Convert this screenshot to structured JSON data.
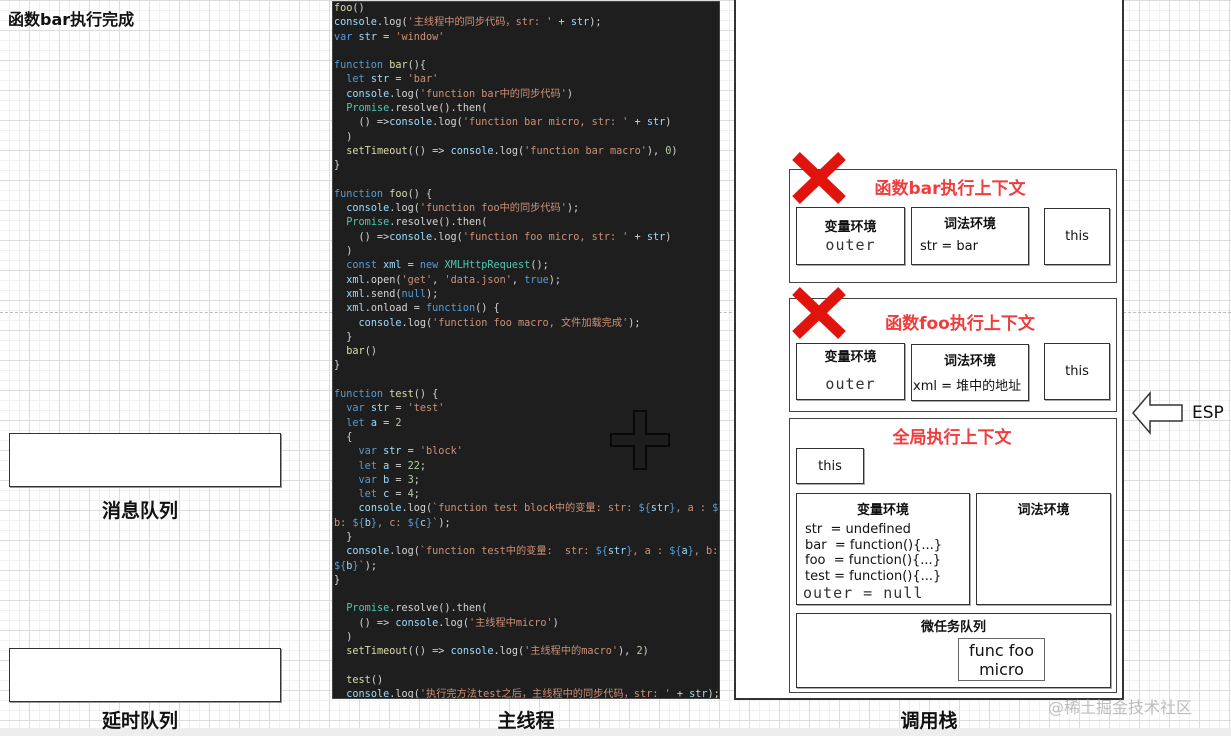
{
  "status_title": "函数bar执行完成",
  "labels": {
    "message_queue": "消息队列",
    "delay_queue": "延时队列",
    "main_thread": "主线程",
    "call_stack": "调用栈"
  },
  "esp_label": "ESP",
  "watermark": "@稀土掘金技术社区",
  "code_lines": [
    [
      [
        "fn",
        "foo"
      ],
      [
        "",
        "()"
      ]
    ],
    [
      [
        "id",
        "console"
      ],
      [
        "",
        ".log("
      ],
      [
        "str",
        "'主线程中的同步代码，str: '"
      ],
      [
        "",
        " + "
      ],
      [
        "id",
        "str"
      ],
      [
        "",
        ");"
      ]
    ],
    [
      [
        "kw",
        "var"
      ],
      [
        "",
        " "
      ],
      [
        "id",
        "str"
      ],
      [
        "",
        " = "
      ],
      [
        "str",
        "'window'"
      ]
    ],
    [],
    [
      [
        "kw",
        "function"
      ],
      [
        "",
        " "
      ],
      [
        "fn",
        "bar"
      ],
      [
        "",
        "(){"
      ]
    ],
    [
      [
        "",
        "  "
      ],
      [
        "kw",
        "let"
      ],
      [
        "",
        " "
      ],
      [
        "id",
        "str"
      ],
      [
        "",
        " = "
      ],
      [
        "str",
        "'bar'"
      ]
    ],
    [
      [
        "",
        "  "
      ],
      [
        "id",
        "console"
      ],
      [
        "",
        ".log("
      ],
      [
        "str",
        "'function bar中的同步代码'"
      ],
      [
        "",
        ")"
      ]
    ],
    [
      [
        "",
        "  "
      ],
      [
        "cls",
        "Promise"
      ],
      [
        "",
        ".resolve().then("
      ]
    ],
    [
      [
        "",
        "    () =>"
      ],
      [
        "id",
        "console"
      ],
      [
        "",
        ".log("
      ],
      [
        "str",
        "'function bar micro, str: '"
      ],
      [
        "",
        " + "
      ],
      [
        "id",
        "str"
      ],
      [
        "",
        ")"
      ]
    ],
    [
      [
        "",
        "  )"
      ]
    ],
    [
      [
        "",
        "  "
      ],
      [
        "fn",
        "setTimeout"
      ],
      [
        "",
        "(() => "
      ],
      [
        "id",
        "console"
      ],
      [
        "",
        ".log("
      ],
      [
        "str",
        "'function bar macro'"
      ],
      [
        "",
        "), "
      ],
      [
        "num",
        "0"
      ],
      [
        "",
        ")"
      ]
    ],
    [
      [
        "",
        "}"
      ]
    ],
    [],
    [
      [
        "kw",
        "function"
      ],
      [
        "",
        " "
      ],
      [
        "fn",
        "foo"
      ],
      [
        "",
        "() {"
      ]
    ],
    [
      [
        "",
        "  "
      ],
      [
        "id",
        "console"
      ],
      [
        "",
        ".log("
      ],
      [
        "str",
        "'function foo中的同步代码'"
      ],
      [
        "",
        ");"
      ]
    ],
    [
      [
        "",
        "  "
      ],
      [
        "cls",
        "Promise"
      ],
      [
        "",
        ".resolve().then("
      ]
    ],
    [
      [
        "",
        "    () =>"
      ],
      [
        "id",
        "console"
      ],
      [
        "",
        ".log("
      ],
      [
        "str",
        "'function foo micro, str: '"
      ],
      [
        "",
        " + "
      ],
      [
        "id",
        "str"
      ],
      [
        "",
        ")"
      ]
    ],
    [
      [
        "",
        "  )"
      ]
    ],
    [
      [
        "",
        "  "
      ],
      [
        "kw",
        "const"
      ],
      [
        "",
        " "
      ],
      [
        "id",
        "xml"
      ],
      [
        "",
        " = "
      ],
      [
        "kw",
        "new"
      ],
      [
        "",
        " "
      ],
      [
        "cls",
        "XMLHttpRequest"
      ],
      [
        "",
        "();"
      ]
    ],
    [
      [
        "",
        "  "
      ],
      [
        "id",
        "xml"
      ],
      [
        "",
        ".open("
      ],
      [
        "str",
        "'get'"
      ],
      [
        "",
        ", "
      ],
      [
        "str",
        "'data.json'"
      ],
      [
        "",
        ", "
      ],
      [
        "kw",
        "true"
      ],
      [
        "",
        ");"
      ]
    ],
    [
      [
        "",
        "  "
      ],
      [
        "id",
        "xml"
      ],
      [
        "",
        ".send("
      ],
      [
        "kw",
        "null"
      ],
      [
        "",
        ");"
      ]
    ],
    [
      [
        "",
        "  "
      ],
      [
        "id",
        "xml"
      ],
      [
        "",
        ".onload = "
      ],
      [
        "kw",
        "function"
      ],
      [
        "",
        "() {"
      ]
    ],
    [
      [
        "",
        "    "
      ],
      [
        "id",
        "console"
      ],
      [
        "",
        ".log("
      ],
      [
        "str",
        "'function foo macro, 文件加载完成'"
      ],
      [
        "",
        ");"
      ]
    ],
    [
      [
        "",
        "  }"
      ]
    ],
    [
      [
        "",
        "  "
      ],
      [
        "fn",
        "bar"
      ],
      [
        "",
        "()"
      ]
    ],
    [
      [
        "",
        "}"
      ]
    ],
    [],
    [
      [
        "kw",
        "function"
      ],
      [
        "",
        " "
      ],
      [
        "fn",
        "test"
      ],
      [
        "",
        "() {"
      ]
    ],
    [
      [
        "",
        "  "
      ],
      [
        "kw",
        "var"
      ],
      [
        "",
        " "
      ],
      [
        "id",
        "str"
      ],
      [
        "",
        " = "
      ],
      [
        "str",
        "'test'"
      ]
    ],
    [
      [
        "",
        "  "
      ],
      [
        "kw",
        "let"
      ],
      [
        "",
        " "
      ],
      [
        "id",
        "a"
      ],
      [
        "",
        " = "
      ],
      [
        "num",
        "2"
      ]
    ],
    [
      [
        "",
        "  {"
      ]
    ],
    [
      [
        "",
        "    "
      ],
      [
        "kw",
        "var"
      ],
      [
        "",
        " "
      ],
      [
        "id",
        "str"
      ],
      [
        "",
        " = "
      ],
      [
        "str",
        "'block'"
      ]
    ],
    [
      [
        "",
        "    "
      ],
      [
        "kw",
        "let"
      ],
      [
        "",
        " "
      ],
      [
        "id",
        "a"
      ],
      [
        "",
        " = "
      ],
      [
        "num",
        "22"
      ],
      [
        "",
        ";"
      ]
    ],
    [
      [
        "",
        "    "
      ],
      [
        "kw",
        "var"
      ],
      [
        "",
        " "
      ],
      [
        "id",
        "b"
      ],
      [
        "",
        " = "
      ],
      [
        "num",
        "3"
      ],
      [
        "",
        ";"
      ]
    ],
    [
      [
        "",
        "    "
      ],
      [
        "kw",
        "let"
      ],
      [
        "",
        " "
      ],
      [
        "id",
        "c"
      ],
      [
        "",
        " = "
      ],
      [
        "num",
        "4"
      ],
      [
        "",
        ";"
      ]
    ],
    [
      [
        "",
        "    "
      ],
      [
        "id",
        "console"
      ],
      [
        "",
        ".log("
      ],
      [
        "str",
        "`function test block中的变量: str: "
      ],
      [
        "kw",
        "${"
      ],
      [
        "id",
        "str"
      ],
      [
        "kw",
        "}"
      ],
      [
        "str",
        ", a : "
      ],
      [
        "kw",
        "${"
      ],
      [
        "id",
        "a"
      ],
      [
        "kw",
        "}"
      ],
      [
        "str",
        ","
      ]
    ],
    [
      [
        "str",
        "b: "
      ],
      [
        "kw",
        "${"
      ],
      [
        "id",
        "b"
      ],
      [
        "kw",
        "}"
      ],
      [
        "str",
        ", c: "
      ],
      [
        "kw",
        "${"
      ],
      [
        "id",
        "c"
      ],
      [
        "kw",
        "}"
      ],
      [
        "str",
        "`"
      ],
      [
        "",
        ");"
      ]
    ],
    [
      [
        "",
        "  }"
      ]
    ],
    [
      [
        "",
        "  "
      ],
      [
        "id",
        "console"
      ],
      [
        "",
        ".log("
      ],
      [
        "str",
        "`function test中的变量:  str: "
      ],
      [
        "kw",
        "${"
      ],
      [
        "id",
        "str"
      ],
      [
        "kw",
        "}"
      ],
      [
        "str",
        ", a : "
      ],
      [
        "kw",
        "${"
      ],
      [
        "id",
        "a"
      ],
      [
        "kw",
        "}"
      ],
      [
        "str",
        ", b:"
      ]
    ],
    [
      [
        "kw",
        "${"
      ],
      [
        "id",
        "b"
      ],
      [
        "kw",
        "}"
      ],
      [
        "str",
        "`"
      ],
      [
        "",
        ");"
      ]
    ],
    [
      [
        "",
        "}"
      ]
    ],
    [],
    [
      [
        "",
        "  "
      ],
      [
        "cls",
        "Promise"
      ],
      [
        "",
        ".resolve().then("
      ]
    ],
    [
      [
        "",
        "    () => "
      ],
      [
        "id",
        "console"
      ],
      [
        "",
        ".log("
      ],
      [
        "str",
        "'主线程中micro'"
      ],
      [
        "",
        ")"
      ]
    ],
    [
      [
        "",
        "  )"
      ]
    ],
    [
      [
        "",
        "  "
      ],
      [
        "fn",
        "setTimeout"
      ],
      [
        "",
        "(() => "
      ],
      [
        "id",
        "console"
      ],
      [
        "",
        ".log("
      ],
      [
        "str",
        "'主线程中的macro'"
      ],
      [
        "",
        "), "
      ],
      [
        "num",
        "2"
      ],
      [
        "",
        ")"
      ]
    ],
    [],
    [
      [
        "",
        "  "
      ],
      [
        "fn",
        "test"
      ],
      [
        "",
        "()"
      ]
    ],
    [
      [
        "",
        "  "
      ],
      [
        "id",
        "console"
      ],
      [
        "",
        ".log("
      ],
      [
        "str",
        "'执行完方法test之后，主线程中的同步代码，str: '"
      ],
      [
        "",
        " + "
      ],
      [
        "id",
        "str"
      ],
      [
        "",
        ");"
      ]
    ]
  ],
  "call_stack": {
    "bar_ctx": {
      "title": "函数bar执行上下文",
      "removed": true,
      "variable_env_label": "变量环境",
      "variable_env_value": "outer",
      "lexical_env_label": "词法环境",
      "lexical_env_value": "str = bar",
      "this_label": "this"
    },
    "foo_ctx": {
      "title": "函数foo执行上下文",
      "removed": true,
      "variable_env_label": "变量环境",
      "variable_env_value": "outer",
      "lexical_env_label": "词法环境",
      "lexical_env_value": "xml = 堆中的地址",
      "this_label": "this"
    },
    "global_ctx": {
      "title": "全局执行上下文",
      "this_label": "this",
      "variable_env_label": "变量环境",
      "variable_env_values": [
        "str  = undefined",
        "bar  = function(){...}",
        "foo  = function(){...}",
        "test = function(){...}"
      ],
      "outer_value": "outer = null",
      "lexical_env_label": "词法环境",
      "microtask_label": "微任务队列",
      "microtask_items": [
        "func foo micro"
      ]
    }
  },
  "colors": {
    "accent_red": "#f03c3c",
    "x_red": "#e0140c",
    "code_bg": "#1e1e1e"
  }
}
